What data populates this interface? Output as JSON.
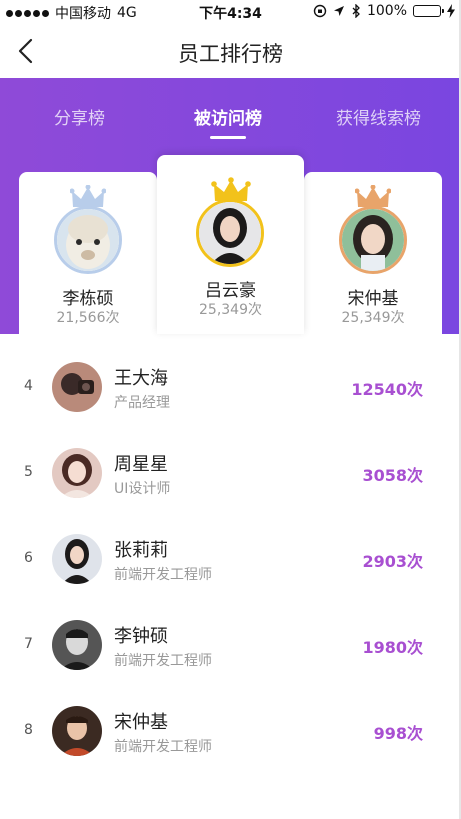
{
  "status_bar": {
    "carrier": "中国移动",
    "network": "4G",
    "time": "下午4:34",
    "battery": "100%"
  },
  "nav": {
    "title": "员工排行榜"
  },
  "tabs": [
    {
      "label": "分享榜",
      "active": false
    },
    {
      "label": "被访问榜",
      "active": true
    },
    {
      "label": "获得线索榜",
      "active": false
    }
  ],
  "podium": {
    "first": {
      "name": "吕云豪",
      "count": "25,349次",
      "crown_color": "#f2c21b"
    },
    "second": {
      "name": "李栋硕",
      "count": "21,566次",
      "crown_color": "#b8cdea"
    },
    "third": {
      "name": "宋仲基",
      "count": "25,349次",
      "crown_color": "#e8a46a"
    }
  },
  "ranking": [
    {
      "rank": "4",
      "name": "王大海",
      "role": "产品经理",
      "value": "12540次"
    },
    {
      "rank": "5",
      "name": "周星星",
      "role": "UI设计师",
      "value": "3058次"
    },
    {
      "rank": "6",
      "name": "张莉莉",
      "role": "前端开发工程师",
      "value": "2903次"
    },
    {
      "rank": "7",
      "name": "李钟硕",
      "role": "前端开发工程师",
      "value": "1980次"
    },
    {
      "rank": "8",
      "name": "宋仲基",
      "role": "前端开发工程师",
      "value": "998次"
    }
  ]
}
